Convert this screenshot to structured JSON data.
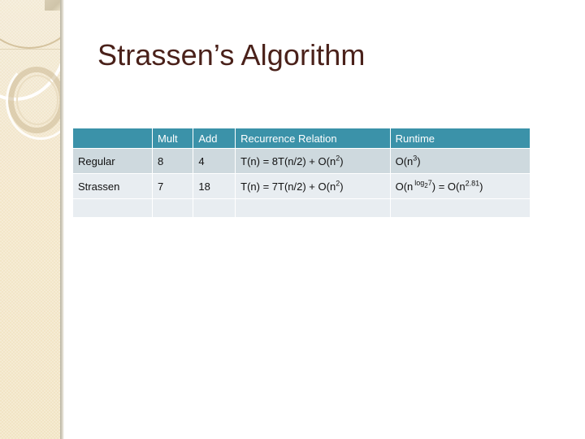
{
  "slide": {
    "title": "Strassen’s Algorithm",
    "background_color": "#ffffff",
    "title_color": "#4a211a",
    "sidebar": {
      "name": "decorative-band",
      "base_color": "#f2e6c9",
      "edge_color": "#bfb9a8"
    }
  },
  "table": {
    "header_color": "#3b92a9",
    "row_a_color": "#ced9de",
    "row_b_color": "#e8edf1",
    "columns": [
      {
        "key": "label",
        "label": ""
      },
      {
        "key": "mult",
        "label": "Mult"
      },
      {
        "key": "add",
        "label": "Add"
      },
      {
        "key": "recurrence",
        "label": "Recurrence Relation"
      },
      {
        "key": "runtime",
        "label": "Runtime"
      }
    ],
    "rows": [
      {
        "label": "Regular",
        "mult": "8",
        "add": "4",
        "recurrence_base": "T(n) = 8T(n/2) + O(n",
        "recurrence_exp": "2",
        "recurrence_tail": ")",
        "runtime_base": "O(n",
        "runtime_exp": "3",
        "runtime_tail": ")"
      },
      {
        "label": "Strassen",
        "mult": "7",
        "add": "18",
        "recurrence_base": "T(n) = 7T(n/2) + O(n",
        "recurrence_exp": "2",
        "recurrence_tail": ")",
        "runtime_base": "O(n",
        "runtime_log_prefix": "log",
        "runtime_log_sub": "2",
        "runtime_log_arg": "7",
        "runtime_mid": ") = O(n",
        "runtime_exp2": "2.81",
        "runtime_tail": ")"
      }
    ]
  }
}
